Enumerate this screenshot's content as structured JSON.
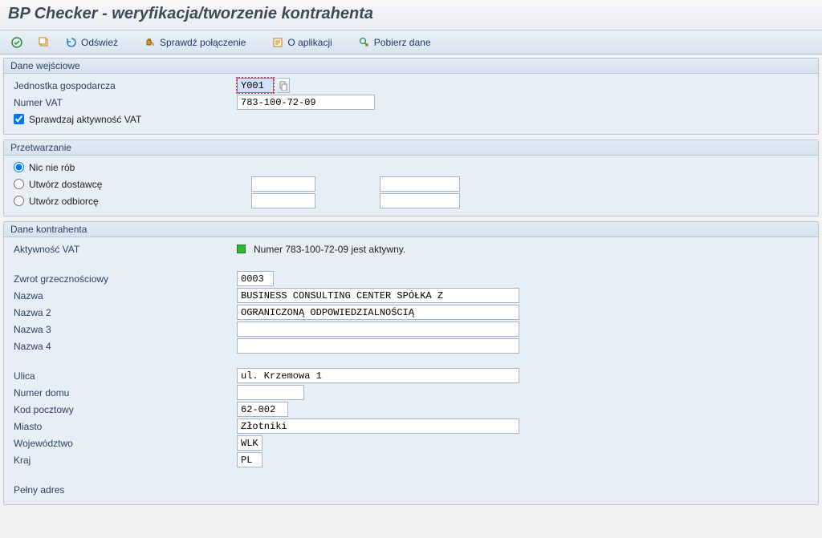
{
  "title": "BP Checker - weryfikacja/tworzenie kontrahenta",
  "toolbar": {
    "refresh": "Odśwież",
    "check_conn": "Sprawdź połączenie",
    "about": "O aplikacji",
    "download": "Pobierz dane"
  },
  "group_input": {
    "title": "Dane wejściowe",
    "bukrs_label": "Jednostka gospodarcza",
    "bukrs_value": "Y001",
    "vat_label": "Numer VAT",
    "vat_value": "783-100-72-09",
    "check_vat_label": "Sprawdzaj aktywność VAT",
    "check_vat_value": true
  },
  "group_proc": {
    "title": "Przetwarzanie",
    "opt_none": "Nic nie rób",
    "opt_supplier": "Utwórz dostawcę",
    "opt_customer": "Utwórz odbiorcę",
    "selected": "none"
  },
  "group_bp": {
    "title": "Dane kontrahenta",
    "vat_act_label": "Aktywność VAT",
    "vat_act_text": "Numer 783-100-72-09 jest aktywny.",
    "title_code_label": "Zwrot grzecznościowy",
    "title_code": "0003",
    "name_label": "Nazwa",
    "name": "BUSINESS CONSULTING CENTER SPÓŁKA Z",
    "name2_label": "Nazwa 2",
    "name2": "OGRANICZONĄ ODPOWIEDZIALNOŚCIĄ",
    "name3_label": "Nazwa 3",
    "name3": "",
    "name4_label": "Nazwa 4",
    "name4": "",
    "street_label": "Ulica",
    "street": "ul. Krzemowa 1",
    "house_label": "Numer domu",
    "house": "",
    "postal_label": "Kod pocztowy",
    "postal": "62-002",
    "city_label": "Miasto",
    "city": "Złotniki",
    "region_label": "Województwo",
    "region": "WLK",
    "country_label": "Kraj",
    "country": "PL",
    "full_addr_label": "Pełny adres"
  }
}
